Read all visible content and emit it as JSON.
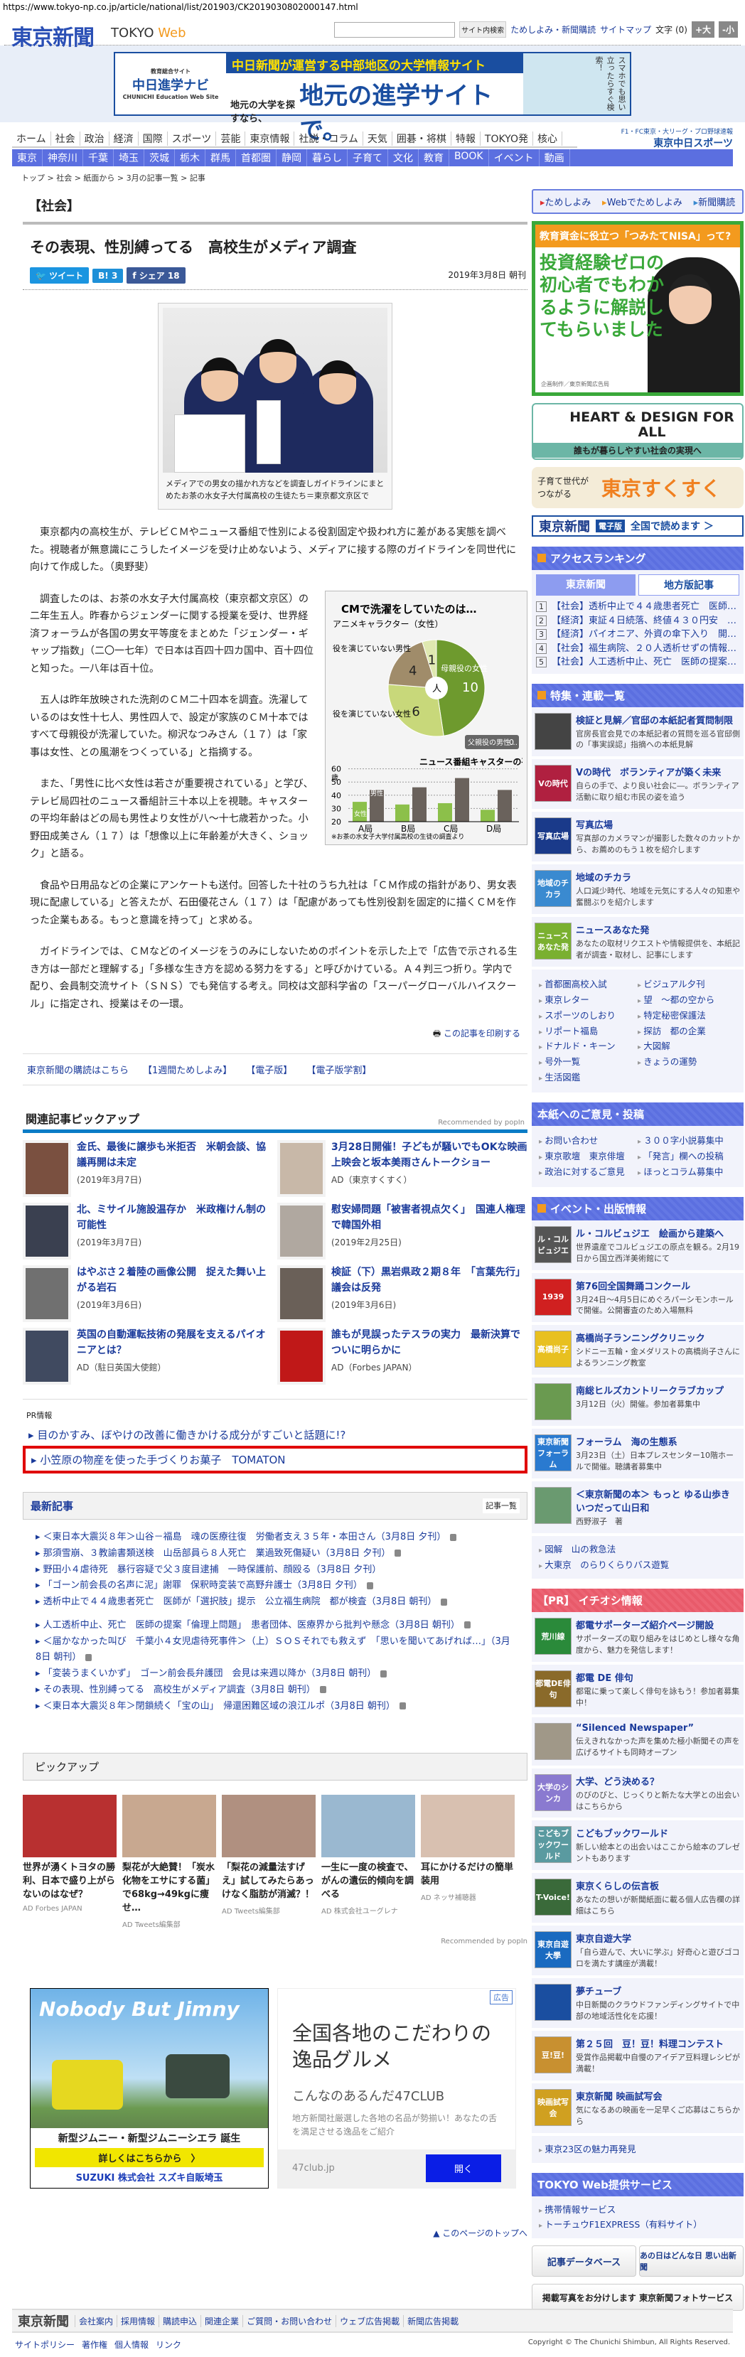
{
  "url": "https://www.tokyo-np.co.jp/article/national/list/201903/CK2019030802000147.html",
  "header": {
    "logo": "東京新聞",
    "logo_tokyo": "TOKYO",
    "logo_web": "Web",
    "search_button": "サイト内検索",
    "links": [
      "ためしよみ・新聞購読",
      "サイトマップ"
    ],
    "font_label": "文字 (0)",
    "font_plus": "+大",
    "font_minus": "-小"
  },
  "banner": {
    "logo_top": "教育総合サイト",
    "logo": "中日進学ナビ",
    "logo_en": "CHUNICHI Education Web Site",
    "top": "中日新聞が運営する中部地区の大学情報サイト",
    "left": "地元の大学を探すなら、",
    "big": "地元の進学サイトで。",
    "side": "スマホでも思い立ったらすぐ検索！"
  },
  "nav": {
    "primary": [
      "ホーム",
      "社会",
      "政治",
      "経済",
      "国際",
      "スポーツ",
      "芸能",
      "東京情報",
      "社説・コラム",
      "天気",
      "囲碁・将棋",
      "特報",
      "TOKYO発",
      "核心"
    ],
    "secondary": [
      "東京",
      "神奈川",
      "千葉",
      "埼玉",
      "茨城",
      "栃木",
      "群馬",
      "首都圏",
      "静岡",
      "暮らし",
      "子育て",
      "文化",
      "教育",
      "BOOK",
      "イベント",
      "動画"
    ],
    "sports_top": "F1・FC東京・大リーグ・プロ野球速報",
    "sports_brand": "東京中日スポーツ"
  },
  "breadcrumb": "トップ > 社会 > 紙面から > 3月の記事一覧 > 記事",
  "article": {
    "category": "【社会】",
    "title": "その表現、性別縛ってる　高校生がメディア調査",
    "share": {
      "tweet": "ツイート",
      "hatena": "B!",
      "hatena_count": "3",
      "facebook": "シェア",
      "facebook_count": "18"
    },
    "date": "2019年3月8日 朝刊",
    "photo_caption": "メディアでの男女の描かれ方などを調査しガイドラインにまとめたお茶の水女子大付属高校の生徒たち＝東京都文京区で",
    "lead": "東京都内の高校生が、テレビＣＭやニュース番組で性別による役割固定や扱われ方に差がある実態を調べた。視聴者が無意識にこうしたイメージを受け止めないよう、メディアに接する際のガイドラインを同世代に向けて作成した。（奥野斐）",
    "paragraphs": [
      "調査したのは、お茶の水女子大付属高校（東京都文京区）の二年生五人。昨春からジェンダーに関する授業を受け、世界経済フォーラムが各国の男女平等度をまとめた「ジェンダー・ギャップ指数」（二〇一七年）で日本は百四十四カ国中、百十四位と知った。一八年は百十位。",
      "五人は昨年放映された洗剤のＣＭ二十四本を調査。洗濯しているのは女性十七人、男性四人で、設定が家族のＣＭ十本ではすべて母親役が洗濯していた。柳沢なつみさん（１７）は「家事は女性、との風潮をつくっている」と指摘する。",
      "また、「男性に比べ女性は若さが重要視されている」と学び、テレビ局四社のニュース番組計三十本以上を視聴。キャスターの平均年齢はどの局も男性より女性が八〜十七歳若かった。小野田成美さん（１７）は「想像以上に年齢差が大きく、ショック」と語る。",
      "食品や日用品などの企業にアンケートも送付。回答した十社のうち九社は「ＣＭ作成の指針があり、男女表現に配慮している」と答えたが、石田優花さん（１７）は「配慮があっても性別役割を固定的に描くＣＭを作った企業もある。もっと意識を持って」と求める。",
      "ガイドラインでは、ＣＭなどのイメージをうのみにしないためのポイントを示した上で「広告で示される生き方は一部だと理解する」「多様な生き方を認める努力をする」と呼びかけている。Ａ４判三つ折り。学内で配り、会員制交流サイト（ＳＮＳ）でも発信する考え。同校は文部科学省の「スーパーグローバルハイスクール」に指定され、授業はその一環。"
    ],
    "print": "この記事を印刷する"
  },
  "chart_data": [
    {
      "type": "pie",
      "title": "CMで洗濯をしていたのは…",
      "center_label": "人",
      "categories": [
        "母親役の女性",
        "役を演じていない女性",
        "役を演じていない男性",
        "アニメキャラクター（女性）",
        "父親役の男性…"
      ],
      "values": [
        10,
        6,
        4,
        1,
        0
      ],
      "colors": [
        "#6e9a2e",
        "#c8d87a",
        "#a08c6a",
        "#dfe8b0",
        "#666666"
      ]
    },
    {
      "type": "bar",
      "title": "ニュース番組キャスターの平均年齢は",
      "ylabel": "歳",
      "ylim": [
        20,
        60
      ],
      "yticks": [
        20,
        30,
        40,
        50,
        60
      ],
      "categories": [
        "A局",
        "B局",
        "C局",
        "D局"
      ],
      "series": [
        {
          "name": "女性",
          "values": [
            35,
            33,
            34,
            29
          ],
          "color": "#8cc04a"
        },
        {
          "name": "男性",
          "values": [
            44,
            46,
            53,
            44
          ],
          "color": "#6a625c"
        }
      ],
      "note": "※お茶の水女子大学付属高校の生徒の調査より"
    }
  ],
  "subscribe": [
    "東京新聞の購読はこちら",
    "【1週間ためしよみ】",
    "【電子版】",
    "【電子版学割】"
  ],
  "related": {
    "title": "関連記事ピックアップ",
    "recommended": "Recommended by popIn",
    "items": [
      {
        "title": "金氏、最後に譲歩も米拒否　米朝会談、協議再開は未定",
        "meta": "(2019年3月7日)",
        "color": "#7a5040"
      },
      {
        "title": "3月28日開催！子どもが騒いでもOKな映画上映会と坂本美雨さんトークショー",
        "meta": "AD（東京すくすく）",
        "color": "#c8b8a8"
      },
      {
        "title": "北、ミサイル施設温存か　米政権けん制の可能性",
        "meta": "(2019年3月7日)",
        "color": "#3a4050"
      },
      {
        "title": "慰安婦問題「被害者視点欠く」　国連人権理で韓国外相",
        "meta": "(2019年2月25日)",
        "color": "#b0a8a0"
      },
      {
        "title": "はやぶさ２着陸の画像公開　捉えた舞い上がる岩石",
        "meta": "(2019年3月6日)",
        "color": "#707070"
      },
      {
        "title": "検証（下）黒岩県政２期８年　「言葉先行」議会は反発",
        "meta": "(2019年3月6日)",
        "color": "#6a6058"
      },
      {
        "title": "英国の自動運転技術の発展を支えるパイオニアとは？",
        "meta": "AD（駐日英国大使館）",
        "color": "#404a60"
      },
      {
        "title": "誰もが見誤ったテスラの実力　最新決算でついに明らかに",
        "meta": "AD（Forbes JAPAN）",
        "color": "#c01818"
      }
    ]
  },
  "pr": {
    "label": "PR情報",
    "items": [
      "目のかすみ、ぼやけの改善に働きかける成分がすごいと話題に!?",
      "小笠原の物産を使った手づくりお菓子　TOMATON"
    ]
  },
  "latest": {
    "title": "最新記事",
    "more": "記事一覧",
    "items": [
      {
        "text": "＜東日本大震災８年＞山谷－福島　魂の医療往復　労働者支え３５年・本田さん（3月8日 夕刊）",
        "lock": true
      },
      {
        "text": "那須雪崩、３教諭書類送検　山岳部員ら８人死亡　業過致死傷疑い（3月8日 夕刊）",
        "lock": true
      },
      {
        "text": "野田小４虐待死　暴行容疑で父３度目逮捕　一時保護前、顔殴る（3月8日 夕刊）",
        "lock": false
      },
      {
        "text": "「ゴーン前会長の名声に泥」謝罪　保釈時変装で高野弁護士（3月8日 夕刊）",
        "lock": true
      },
      {
        "text": "透析中止で４４歳患者死亡　医師が「選択肢」提示　公立福生病院　都が検査（3月8日 朝刊）",
        "lock": true
      },
      {
        "text": "人工透析中止、死亡　医師の提案「倫理上問題」　患者団体、医療界から批判や懸念（3月8日 朝刊）",
        "lock": true
      },
      {
        "text": "＜届かなかった叫び　千葉小４女児虐待死事件＞（上）ＳＯＳそれでも救えず　「思いを聞いてあげれば…」（3月8日 朝刊）",
        "lock": true
      },
      {
        "text": "「変装うまくいかず」　ゴーン前会長弁護団　会見は来週以降か（3月8日 朝刊）",
        "lock": true
      },
      {
        "text": "その表現、性別縛ってる　高校生がメディア調査（3月8日 朝刊）",
        "lock": true
      },
      {
        "text": "＜東日本大震災８年＞閉鎖続く「宝の山」　帰還困難区域の浪江ルポ（3月8日 朝刊）",
        "lock": true
      }
    ]
  },
  "pickup": {
    "title": "ピックアップ",
    "recommended": "Recommended by popIn",
    "items": [
      {
        "title": "世界が湧くトヨタの勝利、日本で盛り上がらないのはなぜ？",
        "source": "AD Forbes JAPAN",
        "color": "#b83030"
      },
      {
        "title": "梨花が大絶賛！「炭水化物をエサにする菌」で68kg→49kgに痩せ…",
        "source": "AD Tweets編集部",
        "color": "#c8a890"
      },
      {
        "title": "「梨花の減量法すげえ」試してみたらあっけなく脂肪が消滅？！",
        "source": "AD Tweets編集部",
        "color": "#b09080"
      },
      {
        "title": "一生に一度の検査で、がんの遺伝的傾向を調べる",
        "source": "AD 株式会社ユーグレナ",
        "color": "#9ab8d0"
      },
      {
        "title": "耳にかけるだけの簡単装用",
        "source": "AD ネッサ補聴器",
        "color": "#d8c0b0"
      }
    ]
  },
  "ads": {
    "jimny": {
      "headline": "Nobody But Jimny",
      "model": "新型ジムニー・新型ジムニーシエラ 誕生",
      "cta": "詳しくはこちらから　〉",
      "dealer": "SUZUKI 株式会社 スズキ自販埼玉"
    },
    "club": {
      "tag": "広告",
      "headline": "全国各地のこだわりの逸品グルメ",
      "name": "こんなのあるんだ47CLUB",
      "desc": "地方新聞社厳選した各地の名品が勢揃い！あなたの舌を満足させる逸品をご紹介",
      "domain": "47club.jp",
      "button": "開く"
    }
  },
  "page_top": "▲ このページのトップへ",
  "footer": {
    "logo": "東京新聞",
    "links": [
      "会社案内",
      "採用情報",
      "購読申込",
      "関連企業",
      "ご質問・お問い合わせ",
      "ウェブ広告掲載",
      "新聞広告掲載"
    ],
    "sub_links": [
      "サイトポリシー",
      "著作権",
      "個人情報",
      "リンク"
    ],
    "copyright": "Copyright © The Chunichi Shimbun, All Rights Reserved."
  },
  "sidebar": {
    "trial": [
      "ためしよみ",
      "Webでためしよみ",
      "新聞購読"
    ],
    "nisa": {
      "top": "教育資金に役立つ「つみたてNISA」って?",
      "main": "投資経験ゼロの初心者でもわかるように解説してもらいました",
      "note": "企画制作／東京新聞広告局"
    },
    "heart": {
      "title": "HEART & DESIGN FOR ALL",
      "sub": "誰もが暮らしやすい社会の実現へ"
    },
    "sukusuku": {
      "small": "子育て世代がつながる",
      "big": "東京すくすく"
    },
    "denshi": {
      "logo": "東京新聞",
      "tag": "電子版",
      "text": "全国で読めます ＞"
    },
    "ranking": {
      "title": "アクセスランキング",
      "tabs": [
        "東京新聞",
        "地方版記事"
      ],
      "items": [
        "【社会】透析中止で４４歳患者死亡　医師…",
        "【経済】東証４日続落、終値４３０円安　…",
        "【経済】パイオニア、外資の傘下入り　開…",
        "【社会】福生病院、２０人透析せずの情報…",
        "【社会】人工透析中止、死亡　医師の提案…"
      ]
    },
    "features": {
      "title": "特集・連載一覧",
      "items": [
        {
          "thumb": "",
          "title": "検証と見解／官邸の本紙記者質問制限",
          "desc": "官房長官会見での本紙記者の質問を巡る官邸側の「事実誤認」指摘への本紙見解",
          "color": "#444"
        },
        {
          "thumb": "Vの時代",
          "title": "Vの時代　ボランティアが築く未来",
          "desc": "自らの手で、より良い社会に―。ボランティア活動に取り組む市民の姿を追う",
          "color": "#b02040"
        },
        {
          "thumb": "写真広場",
          "title": "写真広場",
          "desc": "写真部のカメラマンが撮影した数々のカットから、お薦めのもう１枚を紹介します",
          "color": "#1a3a8a"
        },
        {
          "thumb": "地域のチカラ",
          "title": "地域のチカラ",
          "desc": "人口減少時代、地域を元気にする人々の知恵や奮闘ぶりを紹介します",
          "color": "#3a8ad0"
        },
        {
          "thumb": "ニュースあなた発",
          "title": "ニュースあなた発",
          "desc": "あなたの取材リクエストや情報提供を、本紙記者が調査・取材し、記事にします",
          "color": "#7ab030"
        }
      ],
      "links": [
        "首都圏高校入試",
        "ビジュアル夕刊",
        "東京レター",
        "望　～都の空から",
        "スポーツのしおり",
        "特定秘密保護法",
        "リポート福島",
        "探訪　都の企業",
        "ドナルド・キーン",
        "大図解",
        "号外一覧",
        "きょうの運勢",
        "生活図鑑"
      ]
    },
    "opinion": {
      "title": "本紙へのご意見・投稿",
      "links": [
        "お問い合わせ",
        "３００字小説募集中",
        "東京歌壇　東京俳壇",
        "「発言」欄への投稿",
        "政治に対するご意見",
        "ほっとコラム募集中"
      ]
    },
    "events": {
      "title": "イベント・出版情報",
      "items": [
        {
          "thumb": "ル・コルビュジエ",
          "title": "ル・コルビュジエ　絵画から建築へ",
          "desc": "世界遺産でコルビュジエの原点を観る。2月19日から国立西洋美術館にて",
          "color": "#555"
        },
        {
          "thumb": "1939",
          "title": "第76回全国舞踊コンクール",
          "desc": "3月24日～4月5日にめぐろパーシモンホールで開催。公開審査のため入場無料",
          "color": "#d02020"
        },
        {
          "thumb": "高橋尚子",
          "title": "高橋尚子ランニングクリニック",
          "desc": "シドニー五輪・金メダリストの高橋尚子さんによるランニング教室",
          "color": "#e8c020"
        },
        {
          "thumb": "",
          "title": "南総ヒルズカントリークラブカップ",
          "desc": "3月12日（火）開催。参加者募集中",
          "color": "#6a9a50"
        },
        {
          "thumb": "東京新聞フォーラム",
          "title": "フォーラム　海の生態系",
          "desc": "3月23日（土）日本プレスセンター10階ホールで開催。聴講者募集中",
          "color": "#2a7ad0"
        },
        {
          "thumb": "",
          "title": "＜東京新聞の本＞ もっと ゆる山歩き　いつだって山日和",
          "desc": "西野淑子　著",
          "color": "#6a9a70"
        }
      ],
      "links": [
        "図解　山の救急法",
        "大東京　のらりくらりバス遊覧"
      ]
    },
    "pr": {
      "title": "【PR】 イチオシ情報",
      "items": [
        {
          "thumb": "荒川線",
          "title": "都電サポーターズ紹介ページ開設",
          "desc": "サポーターズの取り組みをはじめとし様々な角度から、魅力を発信します！",
          "color": "#2a8a3a"
        },
        {
          "thumb": "都電DE俳句",
          "title": "都電 DE 俳句",
          "desc": "都電に乗って楽しく俳句を詠もう！参加者募集中！",
          "color": "#8a6a2a"
        },
        {
          "thumb": "",
          "title": "“Silenced Newspaper”",
          "desc": "伝えきれなかった声を集めた極小新聞その声を広げるサイトも同時オープン",
          "color": "#a09888"
        },
        {
          "thumb": "大学のシンカ",
          "title": "大学、どう決める？",
          "desc": "のびのびと、じっくりと新たな大学との出会いはこちらから",
          "color": "#8a7ad0"
        },
        {
          "thumb": "こどもブックワールド",
          "title": "こどもブックワールド",
          "desc": "新しい絵本との出会いはここから絵本のプレゼントもあります",
          "color": "#5a9aa0"
        },
        {
          "thumb": "T-Voice!",
          "title": "東京くらしの伝言板",
          "desc": "あなたの想いが新聞紙面に載る個人広告欄の詳細はこちら",
          "color": "#3a6a3a"
        },
        {
          "thumb": "東京自遊大學",
          "title": "東京自遊大学",
          "desc": "「自ら遊んで、大いに学ぶ」好奇心と遊びゴコロを満たす講座が満載！",
          "color": "#1a6ac0"
        },
        {
          "thumb": "",
          "title": "夢チューブ",
          "desc": "中日新聞のクラウドファンディングサイトで中部の地域活性化を応援！",
          "color": "#1a4ea0"
        },
        {
          "thumb": "豆!豆!",
          "title": "第２５回　豆！豆！料理コンテスト",
          "desc": "受賞作品掲載中自慢のアイデア豆料理レシピが満載！",
          "color": "#c89030"
        },
        {
          "thumb": "映画試写会",
          "title": "東京新聞 映画試写会",
          "desc": "気になるあの映画を一足早くご応募はこちらから",
          "color": "#d0a020"
        }
      ],
      "links": [
        "東京23区の魅力再発見"
      ]
    },
    "services": {
      "title": "TOKYO Web提供サービス",
      "links": [
        "携帯情報サービス",
        "トーチュウF1EXPRESS（有料サイト）"
      ]
    },
    "buttons": [
      "記事データベース",
      "あの日はどんな日 思い出新聞"
    ],
    "photo_service": "掲載写真をお分けします 東京新聞フォトサービス"
  }
}
